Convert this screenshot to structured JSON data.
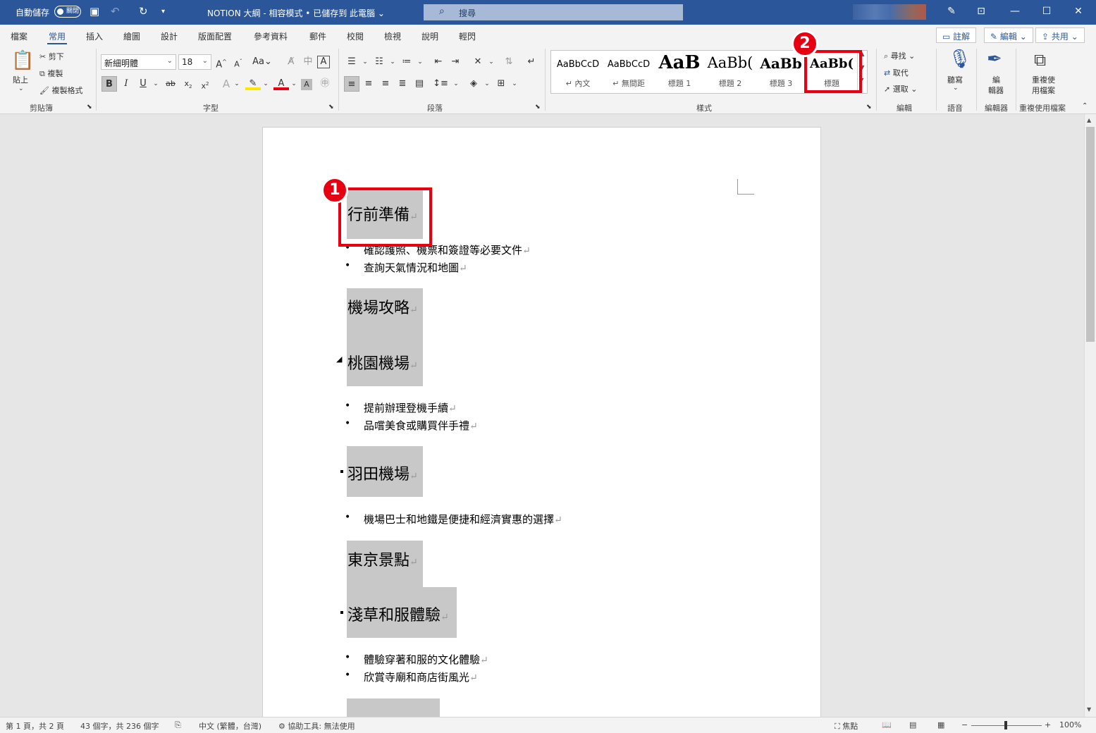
{
  "titlebar": {
    "autosave_label": "自動儲存",
    "autosave_state": "關閉",
    "doc_title": "NOTION 大綱 - 相容模式 • 已儲存到 此電腦 ⌄",
    "search_placeholder": "搜尋"
  },
  "tabs": [
    "檔案",
    "常用",
    "插入",
    "繪圖",
    "設計",
    "版面配置",
    "參考資料",
    "郵件",
    "校閱",
    "檢視",
    "說明",
    "輕閃"
  ],
  "active_tab": "常用",
  "tab_buttons": {
    "comment": "註解",
    "edit": "編輯",
    "share": "共用"
  },
  "clipboard": {
    "paste": "貼上",
    "cut": "剪下",
    "copy": "複製",
    "format_painter": "複製格式",
    "group": "剪貼簿"
  },
  "font": {
    "name": "新細明體",
    "size": "18",
    "group": "字型"
  },
  "paragraph": {
    "group": "段落"
  },
  "styles": {
    "group": "樣式",
    "items": [
      {
        "preview": "AaBbCcD",
        "name": "↵ 內文"
      },
      {
        "preview": "AaBbCcD",
        "name": "↵ 無間距"
      },
      {
        "preview": "AaB",
        "name": "標題 1"
      },
      {
        "preview": "AaBb(",
        "name": "標題 2"
      },
      {
        "preview": "AaBb",
        "name": "標題 3"
      },
      {
        "preview": "AaBb(",
        "name": "標題"
      }
    ]
  },
  "editing": {
    "find": "尋找",
    "replace": "取代",
    "select": "選取",
    "group": "編輯"
  },
  "voice": {
    "dictate": "聽寫",
    "group": "語音"
  },
  "editor": {
    "label_1": "編",
    "label_2": "輯器",
    "group": "編輯器"
  },
  "reuse": {
    "label_1": "重複使",
    "label_2": "用檔案",
    "group": "重複使用檔案"
  },
  "annotations": {
    "badge_1": "1",
    "badge_2": "2"
  },
  "document": {
    "h1": "行前準備",
    "b1": "確認護照、機票和簽證等必要文件",
    "b2": "查詢天氣情況和地圖",
    "h2": "機場攻略",
    "h3": "桃園機場",
    "b3": "提前辦理登機手續",
    "b4": "品嚐美食或購買伴手禮",
    "h4": "羽田機場",
    "b5": "機場巴士和地鐵是便捷和經濟實惠的選擇",
    "h5": "東京景點",
    "h6": "淺草和服體驗",
    "b6": "體驗穿著和服的文化體驗",
    "b7": "欣賞寺廟和商店街風光",
    "para_mark": "↵"
  },
  "status": {
    "page": "第 1 頁，共 2 頁",
    "words": "43 個字，共 236 個字",
    "lang": "中文 (繁體，台灣)",
    "access": "協助工具: 無法使用",
    "focus": "焦點",
    "zoom": "100%"
  },
  "colors": {
    "title_bar": "#2b579a",
    "highlight_red": "#e60012",
    "heading_shade": "#c8c8c8"
  }
}
